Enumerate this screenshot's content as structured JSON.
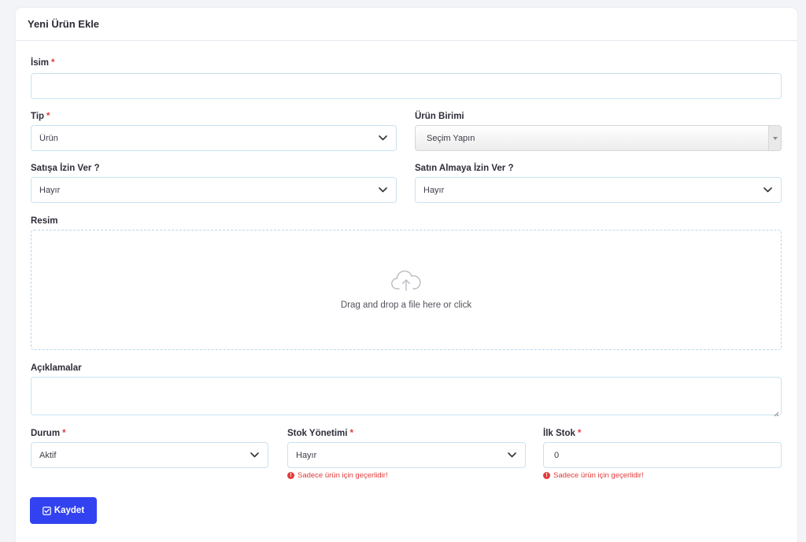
{
  "card": {
    "title": "Yeni Ürün Ekle"
  },
  "name_field": {
    "label": "İsim",
    "required": "*",
    "value": ""
  },
  "type_field": {
    "label": "Tip",
    "required": "*",
    "value": "Ürün"
  },
  "unit_field": {
    "label": "Ürün Birimi",
    "value": "Seçim Yapın"
  },
  "sale_field": {
    "label": "Satışa İzin Ver ?",
    "value": "Hayır"
  },
  "purchase_field": {
    "label": "Satın Almaya İzin Ver ?",
    "value": "Hayır"
  },
  "image_field": {
    "label": "Resim",
    "dropzone_text": "Drag and drop a file here or click"
  },
  "description_field": {
    "label": "Açıklamalar",
    "value": ""
  },
  "status_field": {
    "label": "Durum",
    "required": "*",
    "value": "Aktif"
  },
  "stock_mgmt_field": {
    "label": "Stok Yönetimi",
    "required": "*",
    "value": "Hayır",
    "hint": "Sadece ürün için geçerlidir!"
  },
  "initial_stock_field": {
    "label": "İlk Stok",
    "required": "*",
    "value": "0",
    "hint": "Sadece ürün için geçerlidir!"
  },
  "save_button": {
    "label": "Kaydet"
  },
  "icons": {
    "chevron": "chevron-down-icon",
    "upload": "cloud-upload-icon",
    "check": "checkbox-icon",
    "error": "exclamation-circle-icon"
  },
  "colors": {
    "primary": "#3242f0",
    "required": "#e23b3b",
    "field_border": "#c9e2f0"
  }
}
